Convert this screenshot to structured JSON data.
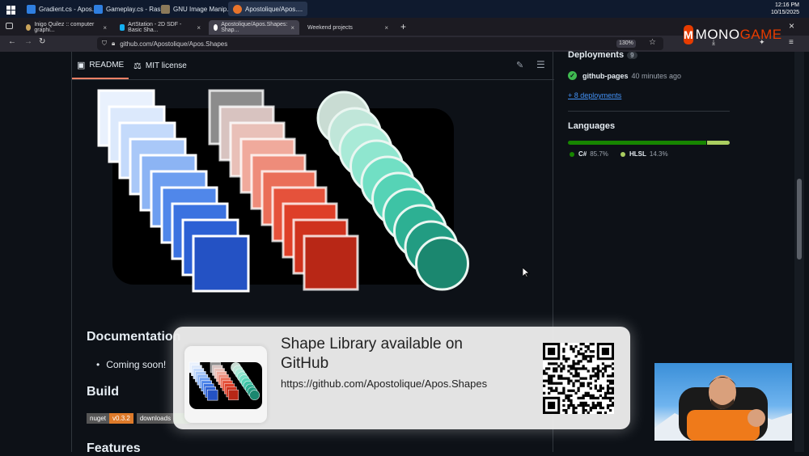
{
  "taskbar": {
    "items": [
      {
        "label": "Gradient.cs - Apos...",
        "icon": "vscode-icon",
        "color": "#2f7fe0"
      },
      {
        "label": "Gameplay.cs - Rash...",
        "icon": "vscode-icon",
        "color": "#2f7fe0"
      },
      {
        "label": "GNU Image Manip...",
        "icon": "gimp-icon",
        "color": "#8c7a5a"
      },
      {
        "label": "Apostolique/Apos....",
        "icon": "firefox-icon",
        "color": "#e8742b"
      }
    ],
    "time": "12:16 PM",
    "date": "10/15/2025"
  },
  "tabs": [
    {
      "label": "Inigo Quilez :: computer graphi...",
      "icon": "web-icon",
      "active": false
    },
    {
      "label": "ArtStation - 2D SDF - Basic Sha...",
      "icon": "artstation-icon",
      "active": false
    },
    {
      "label": "Apostolique/Apos.Shapes: Shap...",
      "icon": "github-icon",
      "active": true
    },
    {
      "label": "Weekend projects",
      "icon": "",
      "active": false
    }
  ],
  "nav": {
    "url": "github.com/Apostolique/Apos.Shapes",
    "zoom": "130%"
  },
  "logo": {
    "mark": "M",
    "text_a": "MONO",
    "text_b": "GAME"
  },
  "readme": {
    "tab_readme": "README",
    "tab_license": "MIT license",
    "doc_heading": "Documentation",
    "doc_item": "Coming soon!",
    "build_heading": "Build",
    "badges": [
      {
        "left": "nuget",
        "right": "v0.3.2",
        "color": "#dd7a2a"
      },
      {
        "left": "downloads",
        "right": "",
        "color": "#4c1"
      }
    ],
    "features_heading": "Features"
  },
  "sidebar": {
    "deployments_heading": "Deployments",
    "deployments_count": "9",
    "deploy_name": "github-pages",
    "deploy_time": "40 minutes ago",
    "more_deployments": "+ 8 deployments",
    "languages_heading": "Languages",
    "languages": [
      {
        "name": "C#",
        "percent": "85.7%",
        "color": "#178600",
        "share": 85.7
      },
      {
        "name": "HLSL",
        "percent": "14.3%",
        "color": "#aace60",
        "share": 14.3
      }
    ]
  },
  "overlay": {
    "title_line1": "Shape Library available on",
    "title_line2": "GitHub",
    "url": "https://github.com/Apostolique/Apos.Shapes"
  },
  "colors": {
    "blue_squares": [
      "#e9f1fd",
      "#dce9fc",
      "#c4dafb",
      "#a9c8f8",
      "#8cb4f4",
      "#6d9ef0",
      "#5087ea",
      "#3b72e0",
      "#2c60d4",
      "#2452c4"
    ],
    "red_squares": [
      "#8c8c8c",
      "#d8c3c0",
      "#e9c0b8",
      "#f0aa9c",
      "#ee8c7a",
      "#ea6e58",
      "#e5523b",
      "#de3f28",
      "#cf321d",
      "#b82716"
    ],
    "teal_circles": [
      "#c9dcd3",
      "#c0e6d9",
      "#a9ead7",
      "#8fe6cf",
      "#71dfc4",
      "#56d3b6",
      "#3ec3a5",
      "#2db093",
      "#229c82",
      "#1b876f"
    ]
  }
}
